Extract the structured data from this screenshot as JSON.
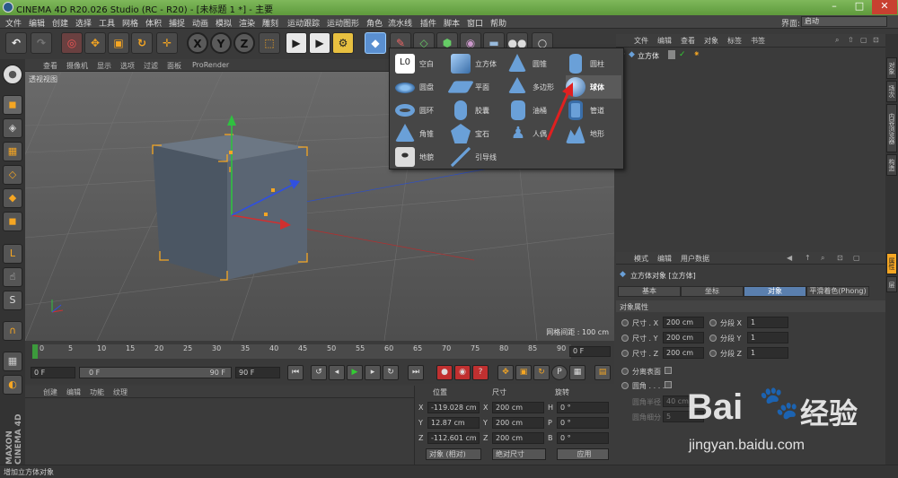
{
  "window": {
    "title": "CINEMA 4D R20.026 Studio (RC - R20) - [未标题 1 *] - 主要",
    "buttons": [
      "–",
      "□",
      "✕"
    ]
  },
  "menubar": {
    "items": [
      "文件",
      "编辑",
      "创建",
      "选择",
      "工具",
      "网格",
      "体积",
      "捕捉",
      "动画",
      "模拟",
      "渲染",
      "雕刻",
      "运动跟踪",
      "运动图形",
      "角色",
      "流水线",
      "插件",
      "脚本",
      "窗口",
      "帮助"
    ],
    "layout_label": "界面:",
    "layout_value": "启动"
  },
  "viewport": {
    "menu": [
      "查看",
      "摄像机",
      "显示",
      "选项",
      "过滤",
      "面板",
      "ProRender"
    ],
    "name": "透视视图",
    "grid_spacing": "网格间距 : 100 cm"
  },
  "timeline": {
    "ticks": [
      "0",
      "5",
      "10",
      "15",
      "20",
      "25",
      "30",
      "35",
      "40",
      "45",
      "50",
      "55",
      "60",
      "65",
      "70",
      "75",
      "80",
      "85",
      "90"
    ],
    "current_frame": "0 F"
  },
  "transport": {
    "start": "0 F",
    "range_left": "0 F",
    "range_right": "90 F",
    "end": "90 F"
  },
  "material": {
    "menu": [
      "创建",
      "编辑",
      "功能",
      "纹理"
    ]
  },
  "coords": {
    "headers": [
      "位置",
      "尺寸",
      "旋转"
    ],
    "rows": [
      {
        "axis": "X",
        "pos": "-119.028 cm",
        "size_axis": "X",
        "size": "200 cm",
        "rot_axis": "H",
        "rot": "0 °"
      },
      {
        "axis": "Y",
        "pos": "12.87 cm",
        "size_axis": "Y",
        "size": "200 cm",
        "rot_axis": "P",
        "rot": "0 °"
      },
      {
        "axis": "Z",
        "pos": "-112.601 cm",
        "size_axis": "Z",
        "size": "200 cm",
        "rot_axis": "B",
        "rot": "0 °"
      }
    ],
    "mode": "对象 (相对)",
    "size_mode": "绝对尺寸",
    "apply": "应用"
  },
  "object_manager": {
    "menu": [
      "文件",
      "编辑",
      "查看",
      "对象",
      "标签",
      "书签"
    ],
    "object_name": "立方体"
  },
  "side_tabs": [
    "对象",
    "场次",
    "内容浏览器",
    "构造"
  ],
  "side_tabs_lower": [
    "属性",
    "层"
  ],
  "attributes": {
    "menu": [
      "模式",
      "编辑",
      "用户数据"
    ],
    "title": "立方体对象 [立方体]",
    "tabs": [
      "基本",
      "坐标",
      "对象",
      "平滑着色(Phong)"
    ],
    "section": "对象属性",
    "size_rows": [
      {
        "label": "尺寸 . X",
        "value": "200 cm",
        "seg_label": "分段 X",
        "seg": "1"
      },
      {
        "label": "尺寸 . Y",
        "value": "200 cm",
        "seg_label": "分段 Y",
        "seg": "1"
      },
      {
        "label": "尺寸 . Z",
        "value": "200 cm",
        "seg_label": "分段 Z",
        "seg": "1"
      }
    ],
    "separate_surfaces": "分离表面",
    "fillet": "圆角 . . . .",
    "fillet_radius_label": "圆角半径",
    "fillet_radius": "40 cm",
    "fillet_sub_label": "圆角细分",
    "fillet_sub": "5"
  },
  "popup": {
    "items": [
      {
        "label": "空白",
        "icon": "null-icon"
      },
      {
        "label": "立方体",
        "icon": "cube-icon"
      },
      {
        "label": "圆锥",
        "icon": "cone-icon"
      },
      {
        "label": "圆柱",
        "icon": "cylinder-icon"
      },
      {
        "label": "圆盘",
        "icon": "disc-icon"
      },
      {
        "label": "平面",
        "icon": "plane-icon"
      },
      {
        "label": "多边形",
        "icon": "polygon-icon"
      },
      {
        "label": "球体",
        "icon": "sphere-icon"
      },
      {
        "label": "圆环",
        "icon": "torus-icon"
      },
      {
        "label": "胶囊",
        "icon": "capsule-icon"
      },
      {
        "label": "油桶",
        "icon": "oiltank-icon"
      },
      {
        "label": "管道",
        "icon": "tube-icon"
      },
      {
        "label": "角锥",
        "icon": "pyramid-icon"
      },
      {
        "label": "宝石",
        "icon": "platonic-icon"
      },
      {
        "label": "人偶",
        "icon": "figure-icon"
      },
      {
        "label": "地形",
        "icon": "landscape-icon"
      },
      {
        "label": "地貌",
        "icon": "relief-icon"
      },
      {
        "label": "引导线",
        "icon": "guide-icon"
      }
    ]
  },
  "status": "增加立方体对象",
  "watermark": {
    "brand": "Bai",
    "brand2": "经验",
    "url": "jingyan.baidu.com"
  },
  "maxon": "MAXON CINEMA 4D",
  "colors": {
    "accent": "#5a7fae",
    "icon_blue": "#6aa0d8",
    "red_arrow": "#e02020",
    "cube": "#4a5560"
  }
}
